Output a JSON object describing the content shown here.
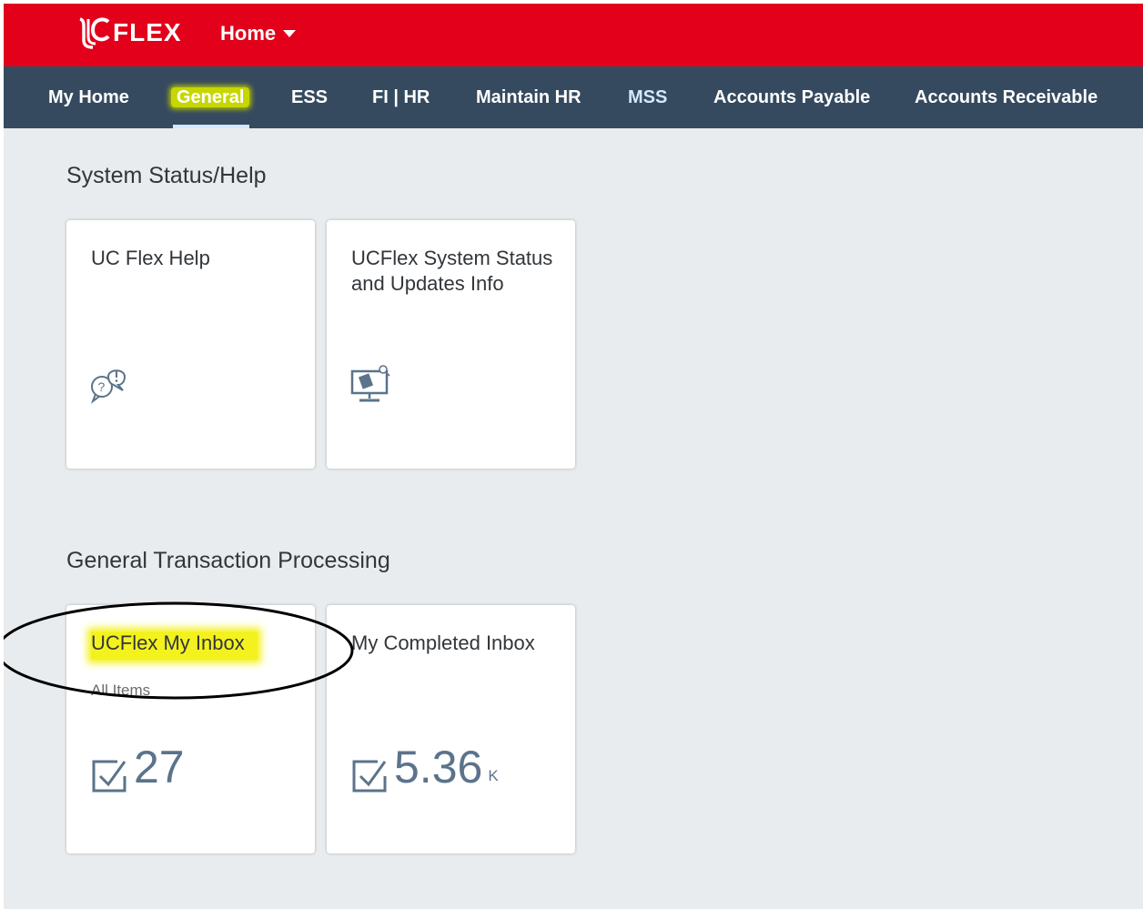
{
  "header": {
    "logo_text": "FLEX",
    "home_label": "Home",
    "bg_color": "#e2001a"
  },
  "nav": {
    "items": [
      {
        "label": "My Home"
      },
      {
        "label": "General"
      },
      {
        "label": "ESS"
      },
      {
        "label": "FI | HR"
      },
      {
        "label": "Maintain HR"
      },
      {
        "label": "MSS"
      },
      {
        "label": "Accounts Payable"
      },
      {
        "label": "Accounts Receivable"
      }
    ],
    "active": "General",
    "bg_color": "#354a5f"
  },
  "sections": [
    {
      "title": "System Status/Help",
      "tiles": [
        {
          "title": "UC Flex Help",
          "icon": "help-chat-icon"
        },
        {
          "title": "UCFlex System Status and Updates Info",
          "icon": "monitor-search-icon"
        }
      ]
    },
    {
      "title": "General Transaction Processing",
      "tiles": [
        {
          "title": "UCFlex My Inbox",
          "subtitle": "All Items",
          "icon": "checkbox-icon",
          "value": "27"
        },
        {
          "title": "My Completed Inbox",
          "icon": "checkbox-icon",
          "value": "5.36",
          "unit": "K"
        }
      ]
    }
  ]
}
